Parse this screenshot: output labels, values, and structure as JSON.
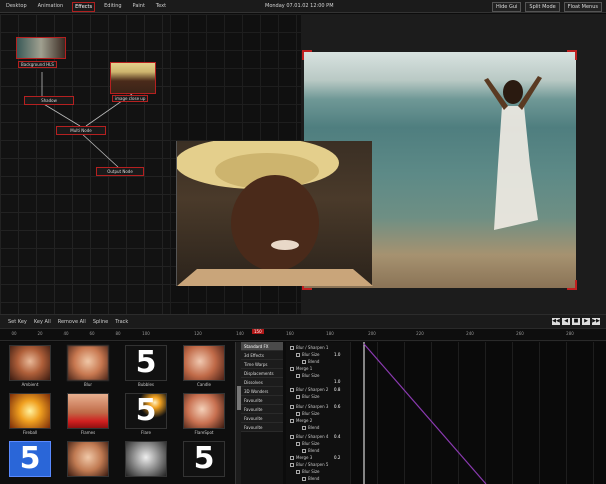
{
  "menu": {
    "items": [
      "Desktop",
      "Animation",
      "Effects",
      "Editing",
      "Paint",
      "Text"
    ],
    "active": 2
  },
  "clock": "Monday 07.01.02 12:00 PM",
  "right_buttons": [
    "Hide Gui",
    "Split Mode",
    "Float Menus"
  ],
  "node_graph": {
    "nodes": {
      "background_label": "Background HLS",
      "image_label": "image close up",
      "shadow": "Shadow",
      "multi_node": "Multi Node",
      "output": "Output Node"
    }
  },
  "timeline": {
    "toolbar": [
      "Set Key",
      "Key All",
      "Remove All",
      "Spline",
      "Track"
    ],
    "transport": [
      "◀◀",
      "◀",
      "■",
      "▶",
      "▶▶"
    ],
    "ruler_ticks": [
      "00",
      "20",
      "40",
      "60",
      "80",
      "100",
      "120",
      "140",
      "160",
      "180",
      "200",
      "220",
      "240",
      "260",
      "280"
    ],
    "playhead": "150"
  },
  "effects": {
    "items": [
      {
        "label": "Ambient"
      },
      {
        "label": "Blur"
      },
      {
        "label": "Bubbles"
      },
      {
        "label": "Candle"
      },
      {
        "label": "Fireball"
      },
      {
        "label": "Flames"
      },
      {
        "label": "Flare"
      },
      {
        "label": "FlareSpot"
      },
      {
        "label": ""
      },
      {
        "label": ""
      },
      {
        "label": ""
      },
      {
        "label": ""
      }
    ],
    "categories": [
      "Standard FX",
      "3d Effects",
      "Time Warps",
      "Displacements",
      "Dissolves",
      "3D Wonders",
      "Favourite",
      "Favourite",
      "Favourite",
      "Favourite"
    ],
    "selected_category": 0
  },
  "layers": [
    {
      "label": "Blur / Sharpen 1",
      "value": "1.0"
    },
    {
      "label": "Blur Size",
      "value": ""
    },
    {
      "label": "Blend",
      "value": ""
    },
    {
      "label": "Merge 1",
      "value": "1.0"
    },
    {
      "label": "Blur Size",
      "value": ""
    },
    {
      "label": "Blur / Sharpen 2",
      "value": "0.8"
    },
    {
      "label": "Blur Size",
      "value": ""
    },
    {
      "label": "Blur / Sharpen 3",
      "value": "0.6"
    },
    {
      "label": "Blur Size",
      "value": ""
    },
    {
      "label": "Merge 2",
      "value": ""
    },
    {
      "label": "Blend",
      "value": ""
    },
    {
      "label": "Blur / Sharpen 4",
      "value": "0.4"
    },
    {
      "label": "Blur Size",
      "value": ""
    },
    {
      "label": "Blend",
      "value": ""
    },
    {
      "label": "Merge 3",
      "value": "0.2"
    },
    {
      "label": "Blur / Sharpen 5",
      "value": ""
    },
    {
      "label": "Blur Size",
      "value": ""
    },
    {
      "label": "Blend",
      "value": ""
    }
  ],
  "colors": {
    "accent": "#c02020",
    "curve": "#8a3ab0",
    "selection": "#2a66d8"
  }
}
